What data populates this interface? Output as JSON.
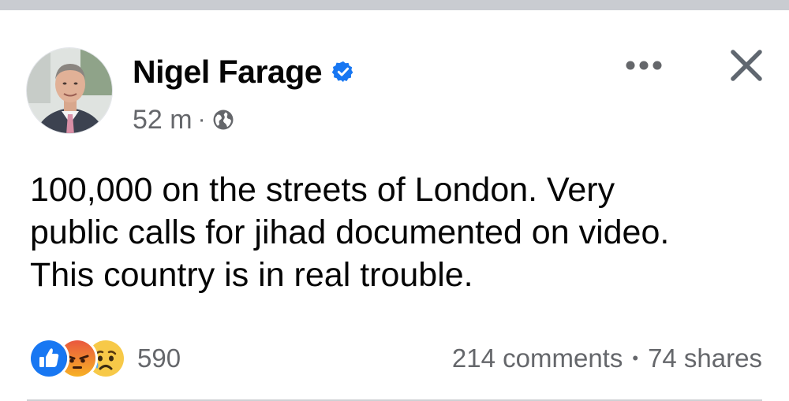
{
  "post": {
    "author": "Nigel Farage",
    "verified_icon": "verified-badge-icon",
    "time": "52 m",
    "separator": "·",
    "audience_icon": "globe-icon",
    "text": "100,000 on the streets of London. Very\npublic calls for jihad documented on video.\nThis country is in real trouble.",
    "more_icon": "more-options-icon",
    "close_icon": "close-icon"
  },
  "reactions": {
    "types": [
      "like",
      "angry",
      "sad"
    ],
    "count": "590"
  },
  "engagement": {
    "comments": "214 comments",
    "bullet": "•",
    "shares": "74 shares"
  },
  "colors": {
    "brand_blue": "#1877f2",
    "secondary_text": "#65676b",
    "primary_text": "#050505",
    "angry_red": "#e9573e",
    "sad_yellow": "#f7b125"
  }
}
